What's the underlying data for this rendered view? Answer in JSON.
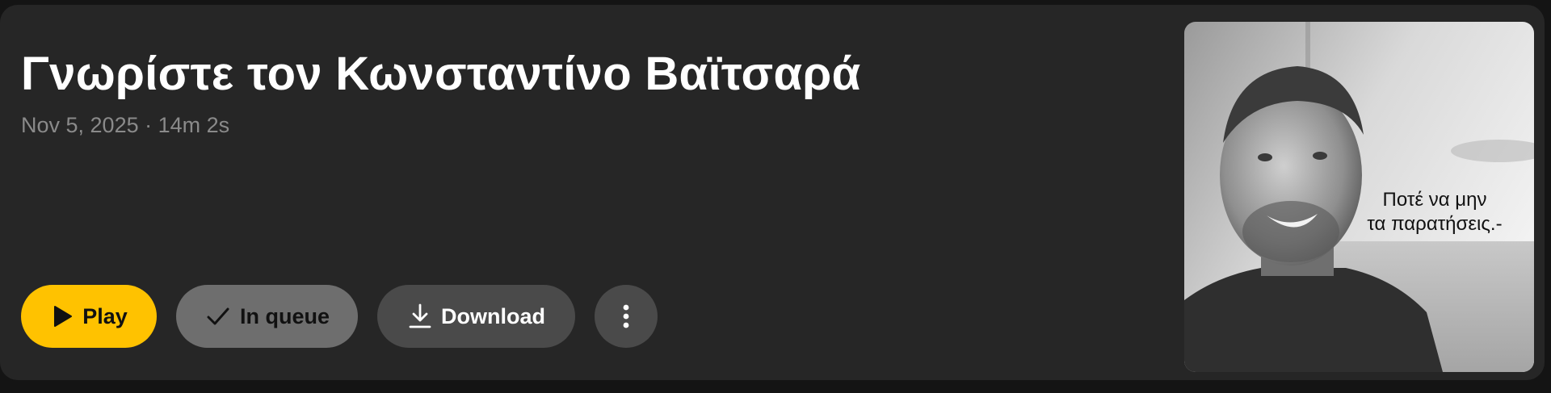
{
  "episode": {
    "title": "Γνωρίστε τον Κωνσταντίνο Βαϊτσαρά",
    "meta": "Nov 5, 2025 · 14m 2s"
  },
  "actions": {
    "play_label": "Play",
    "queue_label": "In queue",
    "download_label": "Download"
  },
  "cover": {
    "caption_line1": "Ποτέ να μην",
    "caption_line2": "τα παρατήσεις.-"
  },
  "colors": {
    "card_bg": "#262626",
    "play_accent": "#ffc200",
    "queue_bg": "#6e6e6e",
    "secondary_button_bg": "#4a4a4a",
    "meta_text": "#8a8a8a"
  },
  "icons": {
    "play": "play-icon",
    "queue": "check-icon",
    "download": "download-icon",
    "more": "more-vertical-icon"
  }
}
